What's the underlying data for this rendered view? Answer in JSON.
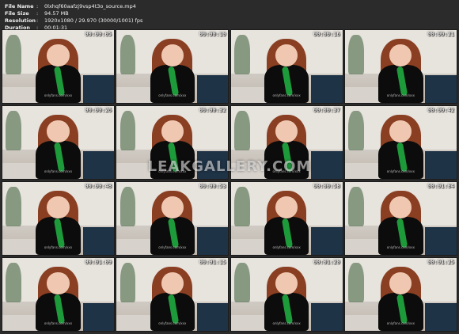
{
  "header": {
    "file_name_label": "File Name",
    "file_name": "0lxhqf60aafzj9vsp4t3o_source.mp4",
    "file_size_label": "File Size",
    "file_size": "94.57 MB",
    "resolution_label": "Resolution",
    "resolution": "1920x1080 / 29.970 (30000/1001) fps",
    "duration_label": "Duration",
    "duration": "00:01:31",
    "separator": ":"
  },
  "thumbnails": [
    {
      "timestamp": "00:00:05",
      "mark": "onlyfans.com/xxx"
    },
    {
      "timestamp": "00:00:10",
      "mark": "onlyfans.com/xxx"
    },
    {
      "timestamp": "00:00:16",
      "mark": "onlyfans.com/xxx"
    },
    {
      "timestamp": "00:00:21",
      "mark": "onlyfans.com/xxx"
    },
    {
      "timestamp": "00:00:26",
      "mark": "onlyfans.com/xxx"
    },
    {
      "timestamp": "00:00:32",
      "mark": "onlyfans.com/xxx"
    },
    {
      "timestamp": "00:00:37",
      "mark": "onlyfans.com/xxx"
    },
    {
      "timestamp": "00:00:42",
      "mark": "onlyfans.com/xxx"
    },
    {
      "timestamp": "00:00:48",
      "mark": "onlyfans.com/xxx"
    },
    {
      "timestamp": "00:00:53",
      "mark": "onlyfans.com/xxx"
    },
    {
      "timestamp": "00:00:58",
      "mark": "onlyfans.com/xxx"
    },
    {
      "timestamp": "00:01:04",
      "mark": "onlyfans.com/xxx"
    },
    {
      "timestamp": "00:01:09",
      "mark": "onlyfans.com/xxx"
    },
    {
      "timestamp": "00:01:15",
      "mark": "onlyfans.com/xxx"
    },
    {
      "timestamp": "00:01:20",
      "mark": "onlyfans.com/xxx"
    },
    {
      "timestamp": "00:01:25",
      "mark": "onlyfans.com/xxx"
    }
  ],
  "watermark": "LEAKGALLERY.COM"
}
